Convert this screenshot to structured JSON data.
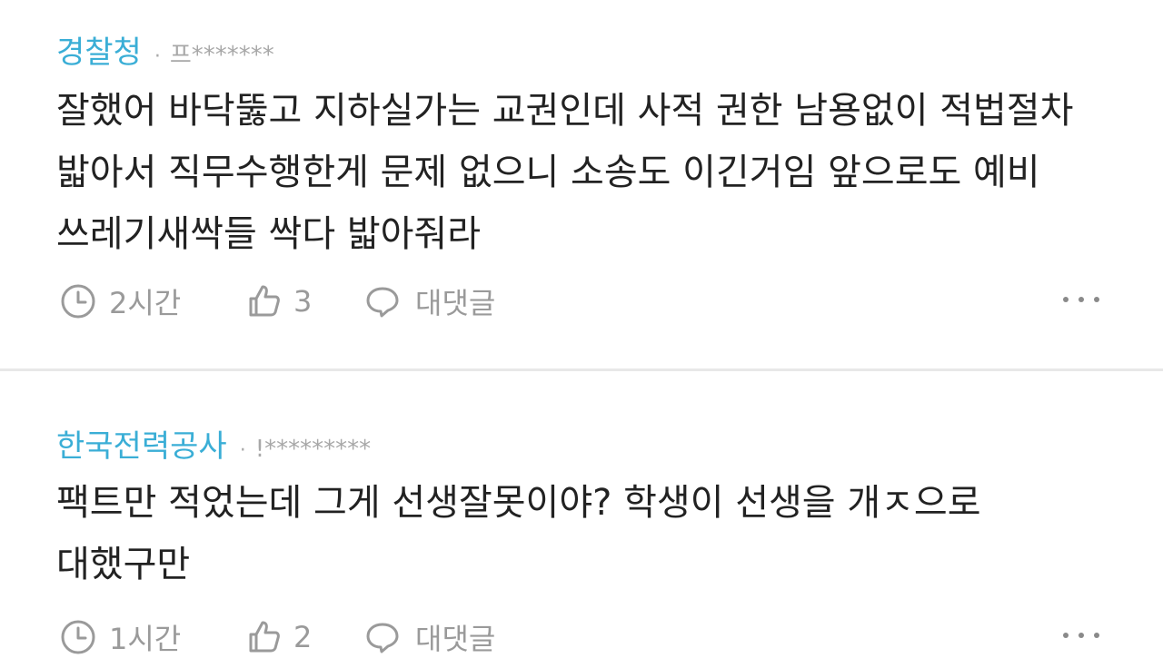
{
  "comments": [
    {
      "author": "경찰청",
      "separator": "·",
      "user_id": "프*******",
      "body": "잘했어 바닥뚫고 지하실가는 교권인데 사적 권한 남용없이 적법절차 밟아서 직무수행한게 문제 없으니 소송도 이긴거임 앞으로도 예비 쓰레기새싹들 싹다 밟아줘라",
      "time": "2시간",
      "likes": "3",
      "reply_label": "대댓글"
    },
    {
      "author": "한국전력공사",
      "separator": "·",
      "user_id": "!*********",
      "body": "팩트만 적었는데 그게 선생잘못이야? 학생이 선생을 개ㅈ으로 대했구만",
      "time": "1시간",
      "likes": "2",
      "reply_label": "대댓글"
    }
  ],
  "icons": {
    "time": "clock-icon",
    "like": "thumbs-up-icon",
    "reply": "speech-bubble-icon",
    "more": "more-dots-icon"
  },
  "colors": {
    "author": "#3aaed6",
    "body_text": "#222222",
    "meta": "#9a9a9a",
    "divider": "#e8e8e8"
  }
}
